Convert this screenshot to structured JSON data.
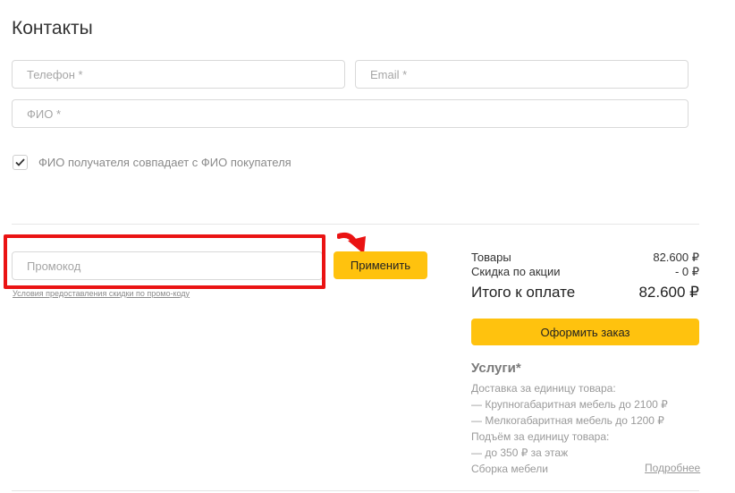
{
  "contacts": {
    "title": "Контакты",
    "phone_placeholder": "Телефон *",
    "email_placeholder": "Email *",
    "name_placeholder": "ФИО *",
    "same_recipient_label": "ФИО получателя совпадает с ФИО покупателя",
    "same_recipient_checked": true
  },
  "promo": {
    "placeholder": "Промокод",
    "apply_label": "Применить",
    "terms_link": "Условия предоставления скидки по промо-коду"
  },
  "summary": {
    "goods_label": "Товары",
    "goods_value": "82.600 ₽",
    "discount_label": "Скидка по акции",
    "discount_value": "- 0 ₽",
    "total_label": "Итого к оплате",
    "total_value": "82.600 ₽",
    "checkout_label": "Оформить заказ"
  },
  "services": {
    "title": "Услуги*",
    "lines": [
      "Доставка за единицу товара:",
      "— Крупногабаритная мебель до 2100 ₽",
      "— Мелкогабаритная мебель до 1200 ₽",
      "Подъём за единицу товара:",
      "— до 350 ₽ за этаж",
      "Сборка мебели"
    ],
    "more_link": "Подробнее"
  },
  "colors": {
    "accent_yellow": "#ffc20e",
    "highlight_red": "#ea1313"
  },
  "icons": {
    "checkbox": "checkmark-icon",
    "annotation": "red-arrow-icon"
  }
}
